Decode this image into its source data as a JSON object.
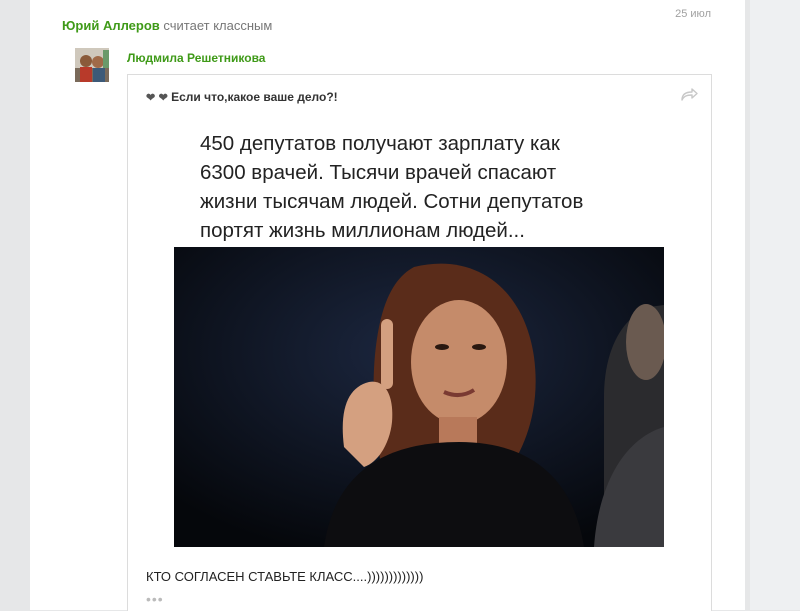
{
  "activity": {
    "liker_name": "Юрий Аллеров",
    "action_text": "считает классным",
    "date": "25 июл"
  },
  "post": {
    "author": "Людмила Решетникова",
    "title": "Если что,какое ваше дело?!",
    "title_prefix_icons": [
      "heart-icon",
      "heart-icon"
    ],
    "share_icon": "share-arrow-icon",
    "image_text": "450 депутатов получают зарплату как\n6300 врачей. Тысячи врачей спасают\nжизни тысячам людей. Сотни депутатов\nпортят жизнь миллионам людей...",
    "text": "КТО СОГЛАСЕН СТАВЬТЕ КЛАСС....)))))))))))))",
    "more": "•••"
  },
  "colors": {
    "name_green": "#3f9a18",
    "photo_background": "#0b0e14"
  }
}
